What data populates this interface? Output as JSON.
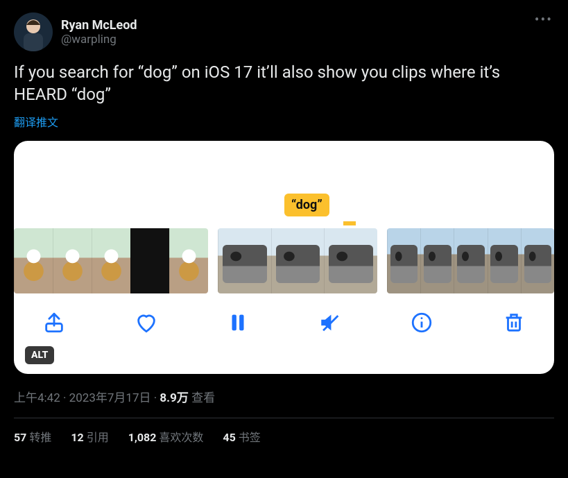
{
  "author": {
    "display_name": "Ryan McLeod",
    "handle": "@warpling"
  },
  "tweet_text": "If you search for “dog” on iOS 17 it’ll also show you clips where it’s HEARD “dog”",
  "translate_label": "翻译推文",
  "attachment": {
    "search_tag": "“dog”",
    "alt_badge": "ALT",
    "toolbar_icons": [
      "share-icon",
      "heart-icon",
      "pause-icon",
      "mute-icon",
      "info-icon",
      "trash-icon"
    ]
  },
  "meta": {
    "time": "上午4:42",
    "date": "2023年7月17日",
    "views_count": "8.9万",
    "views_label": "查看",
    "separator": " · "
  },
  "stats": {
    "retweets_count": "57",
    "retweets_label": "转推",
    "quotes_count": "12",
    "quotes_label": "引用",
    "likes_count": "1,082",
    "likes_label": "喜欢次数",
    "bookmarks_count": "45",
    "bookmarks_label": "书签"
  }
}
